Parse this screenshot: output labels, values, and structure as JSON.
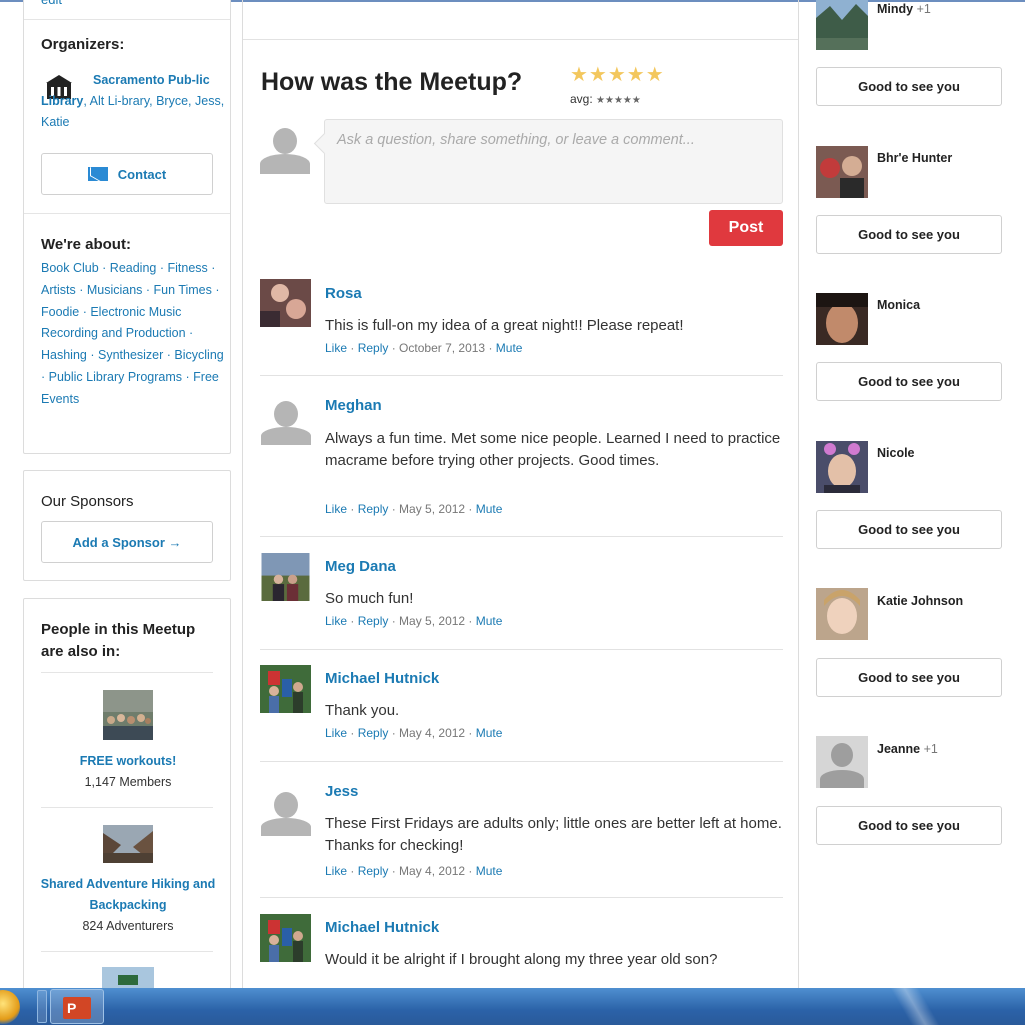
{
  "left": {
    "edit_label": "edit",
    "organizers_heading": "Organizers:",
    "organizer_primary": "Sacramento Pub-lic Library",
    "organizer_others": ", Alt Li-brary, Bryce, Jess, Katie",
    "contact_label": "Contact",
    "about_heading": "We're about:",
    "topics": [
      "Book Club",
      "Reading",
      "Fitness",
      "Artists",
      "Musicians",
      "Fun Times",
      "Foodie",
      "Electronic Music",
      "Recording and Production",
      "Hashing",
      "Synthesizer",
      "Bicycling",
      "Public Library Programs",
      "Free Events"
    ],
    "sponsors_heading": "Our Sponsors",
    "add_sponsor_label": "Add a Sponsor →",
    "people_heading": "People in this Meetup are also in:",
    "groups": [
      {
        "name": "FREE workouts!",
        "count": "1,147 Members"
      },
      {
        "name": "Shared Adventure Hiking and Backpacking",
        "count": "824 Adventurers"
      }
    ]
  },
  "center": {
    "title": "How was the Meetup?",
    "stars": "★★★★★",
    "avg_label": "avg:",
    "avg_stars": "★★★★★",
    "comment_placeholder": "Ask a question, share something, or leave a comment...",
    "post_label": "Post",
    "comments": [
      {
        "name": "Rosa",
        "text": "This is full-on my idea of a great night!! Please repeat!",
        "like": "Like",
        "reply": "Reply",
        "date": "October 7, 2013",
        "mute": "Mute"
      },
      {
        "name": "Meghan",
        "text": "Always a fun time. Met some nice people. Learned I need to practice macrame before trying other projects. Good times.",
        "like": "Like",
        "reply": "Reply",
        "date": "May 5, 2012",
        "mute": "Mute"
      },
      {
        "name": "Meg Dana",
        "text": "So much fun!",
        "like": "Like",
        "reply": "Reply",
        "date": "May 5, 2012",
        "mute": "Mute"
      },
      {
        "name": "Michael Hutnick",
        "text": "Thank you.",
        "like": "Like",
        "reply": "Reply",
        "date": "May 4, 2012",
        "mute": "Mute"
      },
      {
        "name": "Jess",
        "text": "These First Fridays are adults only; little ones are better left at home. Thanks for checking!",
        "like": "Like",
        "reply": "Reply",
        "date": "May 4, 2012",
        "mute": "Mute"
      },
      {
        "name": "Michael Hutnick",
        "text": "Would it be alright if I brought along my three year old son?"
      }
    ]
  },
  "right": {
    "attendees": [
      {
        "name": "Mindy",
        "plus": "+1"
      },
      {
        "name": "Bhr'e Hunter",
        "plus": ""
      },
      {
        "name": "Monica",
        "plus": ""
      },
      {
        "name": "Nicole",
        "plus": ""
      },
      {
        "name": "Katie Johnson",
        "plus": ""
      },
      {
        "name": "Jeanne",
        "plus": "+1"
      }
    ],
    "greet_label": "Good to see you"
  },
  "taskbar": {
    "ppt_letter": "P"
  },
  "colors": {
    "link": "#1b7ab3",
    "post_button": "#e0393e",
    "stars": "#f3c75d",
    "taskbar": "#2b62a8"
  }
}
